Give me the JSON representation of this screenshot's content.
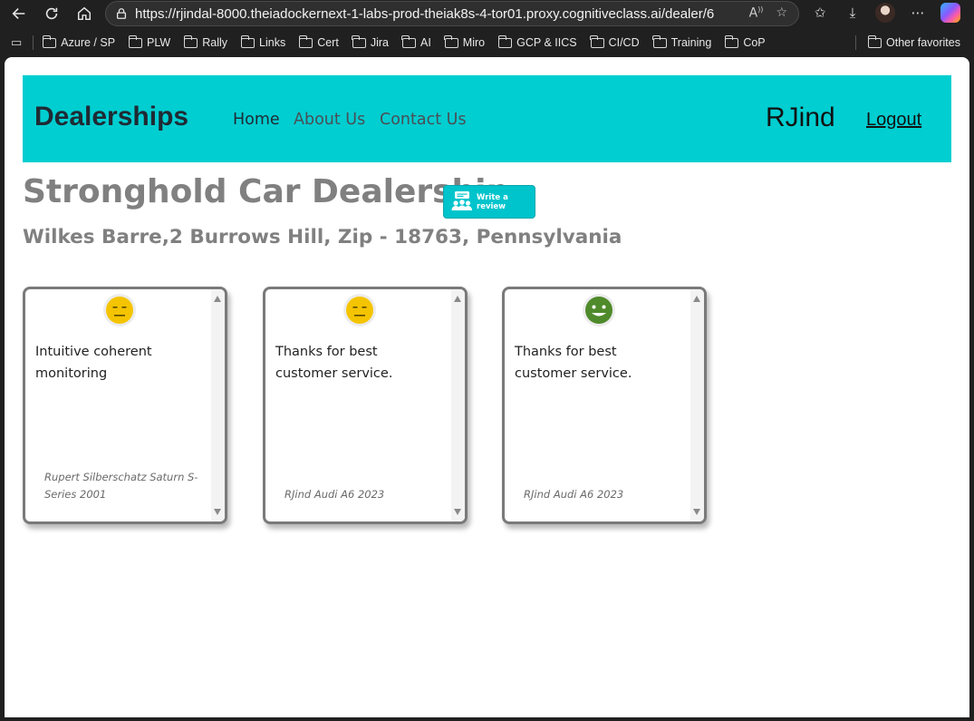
{
  "browser": {
    "url": "https://rjindal-8000.theiadockernext-1-labs-prod-theiak8s-4-tor01.proxy.cognitiveclass.ai/dealer/6",
    "bookmarks": [
      "Azure / SP",
      "PLW",
      "Rally",
      "Links",
      "Cert",
      "Jira",
      "AI",
      "Miro",
      "GCP & IICS",
      "CI/CD",
      "Training",
      "CoP"
    ],
    "other_favorites": "Other favorites"
  },
  "navbar": {
    "brand": "Dealerships",
    "links": [
      "Home",
      "About Us",
      "Contact Us"
    ],
    "user": "RJind",
    "logout": "Logout"
  },
  "dealer": {
    "name": "Stronghold Car Dealership",
    "address": "Wilkes Barre,2 Burrows Hill, Zip - 18763, Pennsylvania",
    "write_review_label": "Write a review"
  },
  "reviews": [
    {
      "sentiment": "neutral",
      "text": "Intuitive coherent monitoring",
      "reviewer": "Rupert Silberschatz Saturn S-Series 2001",
      "emoji_color": "#f5c400"
    },
    {
      "sentiment": "neutral",
      "text": "Thanks for best customer service.",
      "reviewer": "RJind Audi A6 2023",
      "emoji_color": "#f5c400"
    },
    {
      "sentiment": "positive",
      "text": "Thanks for best customer service.",
      "reviewer": "RJind Audi A6 2023",
      "emoji_color": "#4f8a2b"
    }
  ],
  "colors": {
    "navbar_bg": "#00ced1",
    "title_gray": "#808080",
    "button_bg": "#00c4cc"
  }
}
